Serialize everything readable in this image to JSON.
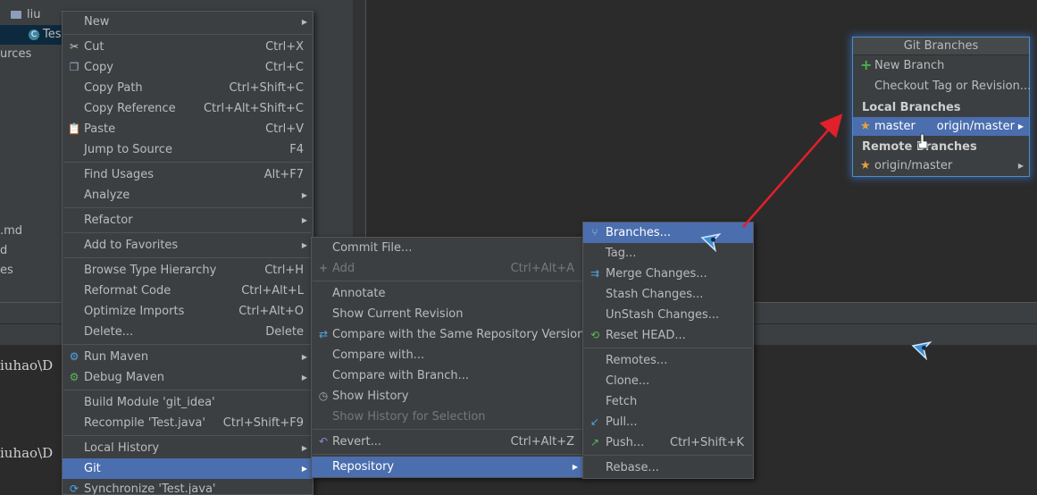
{
  "project_tree": [
    {
      "label": "liu",
      "type": "folder"
    },
    {
      "label": "Tes",
      "type": "class",
      "badge": "C"
    },
    {
      "label": "urces",
      "type": "text"
    },
    {
      "label": ".md",
      "type": "text"
    },
    {
      "label": "d",
      "type": "text"
    },
    {
      "label": "es",
      "type": "text"
    }
  ],
  "terminal": {
    "lines": [
      "iuhao\\D",
      "iuhao\\D"
    ]
  },
  "context_menu": {
    "items": [
      {
        "label": "New",
        "shortcut": "",
        "icon": "",
        "submenu": true
      },
      "sep",
      {
        "label": "Cut",
        "shortcut": "Ctrl+X",
        "icon": "scissors-icon"
      },
      {
        "label": "Copy",
        "shortcut": "Ctrl+C",
        "icon": "copy-icon"
      },
      {
        "label": "Copy Path",
        "shortcut": "Ctrl+Shift+C",
        "icon": ""
      },
      {
        "label": "Copy Reference",
        "shortcut": "Ctrl+Alt+Shift+C",
        "icon": ""
      },
      {
        "label": "Paste",
        "shortcut": "Ctrl+V",
        "icon": "paste-icon"
      },
      {
        "label": "Jump to Source",
        "shortcut": "F4",
        "icon": ""
      },
      "sep",
      {
        "label": "Find Usages",
        "shortcut": "Alt+F7",
        "icon": ""
      },
      {
        "label": "Analyze",
        "shortcut": "",
        "icon": "",
        "submenu": true
      },
      "sep",
      {
        "label": "Refactor",
        "shortcut": "",
        "icon": "",
        "submenu": true
      },
      "sep",
      {
        "label": "Add to Favorites",
        "shortcut": "",
        "icon": "",
        "submenu": true
      },
      "sep",
      {
        "label": "Browse Type Hierarchy",
        "shortcut": "Ctrl+H",
        "icon": ""
      },
      {
        "label": "Reformat Code",
        "shortcut": "Ctrl+Alt+L",
        "icon": ""
      },
      {
        "label": "Optimize Imports",
        "shortcut": "Ctrl+Alt+O",
        "icon": ""
      },
      {
        "label": "Delete...",
        "shortcut": "Delete",
        "icon": ""
      },
      "sep",
      {
        "label": "Run Maven",
        "shortcut": "",
        "icon": "maven-gear-icon",
        "submenu": true
      },
      {
        "label": "Debug Maven",
        "shortcut": "",
        "icon": "maven-debug-icon",
        "submenu": true
      },
      "sep",
      {
        "label": "Build Module 'git_idea'",
        "shortcut": "",
        "icon": ""
      },
      {
        "label": "Recompile 'Test.java'",
        "shortcut": "Ctrl+Shift+F9",
        "icon": ""
      },
      "sep",
      {
        "label": "Local History",
        "shortcut": "",
        "icon": "",
        "submenu": true
      },
      {
        "label": "Git",
        "shortcut": "",
        "icon": "",
        "submenu": true,
        "selected": true
      },
      {
        "label": "Synchronize 'Test.java'",
        "shortcut": "",
        "icon": "sync-icon"
      }
    ]
  },
  "git_menu": {
    "items": [
      {
        "label": "Commit File...",
        "shortcut": "",
        "icon": ""
      },
      {
        "label": "Add",
        "shortcut": "Ctrl+Alt+A",
        "icon": "plus-icon",
        "disabled": true
      },
      "sep",
      {
        "label": "Annotate",
        "shortcut": "",
        "icon": ""
      },
      {
        "label": "Show Current Revision",
        "shortcut": "",
        "icon": ""
      },
      {
        "label": "Compare with the Same Repository Version",
        "shortcut": "",
        "icon": "compare-icon"
      },
      {
        "label": "Compare with...",
        "shortcut": "",
        "icon": ""
      },
      {
        "label": "Compare with Branch...",
        "shortcut": "",
        "icon": ""
      },
      {
        "label": "Show History",
        "shortcut": "",
        "icon": "history-icon"
      },
      {
        "label": "Show History for Selection",
        "shortcut": "",
        "icon": "",
        "disabled": true
      },
      "sep",
      {
        "label": "Revert...",
        "shortcut": "Ctrl+Alt+Z",
        "icon": "revert-icon"
      },
      "sep",
      {
        "label": "Repository",
        "shortcut": "",
        "icon": "",
        "submenu": true,
        "selected": true
      }
    ]
  },
  "repository_menu": {
    "items": [
      {
        "label": "Branches...",
        "icon": "branch-icon",
        "selected": true
      },
      {
        "label": "Tag...",
        "icon": ""
      },
      {
        "label": "Merge Changes...",
        "icon": "merge-icon"
      },
      {
        "label": "Stash Changes...",
        "icon": ""
      },
      {
        "label": "UnStash Changes...",
        "icon": ""
      },
      {
        "label": "Reset HEAD...",
        "icon": "reset-icon"
      },
      "sep",
      {
        "label": "Remotes...",
        "icon": ""
      },
      {
        "label": "Clone...",
        "icon": ""
      },
      {
        "label": "Fetch",
        "icon": ""
      },
      {
        "label": "Pull...",
        "icon": "pull-icon"
      },
      {
        "label": "Push...",
        "shortcut": "Ctrl+Shift+K",
        "icon": "push-icon"
      },
      "sep",
      {
        "label": "Rebase...",
        "icon": ""
      }
    ]
  },
  "branches_popup": {
    "title": "Git Branches",
    "new_branch": "New Branch",
    "checkout_tag": "Checkout Tag or Revision...",
    "local_header": "Local Branches",
    "local_branch": "master",
    "local_tracking": "origin/master",
    "remote_header": "Remote Branches",
    "remote_branch": "origin/master"
  },
  "colors": {
    "selection": "#4b6eaf",
    "annotation_arrow": "#e0202a",
    "menu_bg": "#3c3f41"
  }
}
